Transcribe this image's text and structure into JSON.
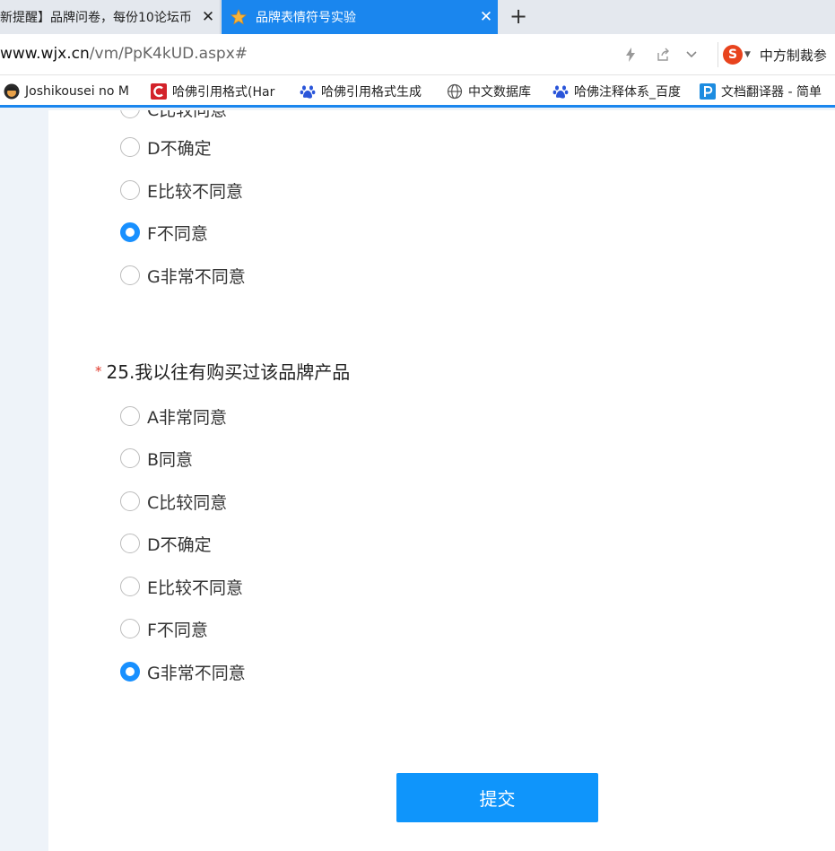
{
  "tabs": [
    {
      "title": "新提醒】品牌问卷，每份10论坛币",
      "close": "✕",
      "active": false
    },
    {
      "title": "品牌表情符号实验",
      "close": "✕",
      "active": true
    }
  ],
  "new_tab_label": "+",
  "address": {
    "host": "www.wjx.cn",
    "path": "/vm/PpK4kUD.aspx#"
  },
  "search_engine": {
    "logo": "S",
    "label": "中方制裁参"
  },
  "bookmarks": [
    {
      "label": "Joshikousei no M",
      "icon": "avatar-icon"
    },
    {
      "label": "哈佛引用格式(Har",
      "icon": "c-logo-icon"
    },
    {
      "label": "哈佛引用格式生成",
      "icon": "paw-icon"
    },
    {
      "label": "中文数据库",
      "icon": "globe-icon"
    },
    {
      "label": "哈佛注释体系_百度",
      "icon": "paw-icon"
    },
    {
      "label": "文档翻译器 - 简单",
      "icon": "p-logo-icon"
    }
  ],
  "prev_question": {
    "partial_option": "C比较同意",
    "options": [
      {
        "label": "D不确定",
        "checked": false
      },
      {
        "label": "E比较不同意",
        "checked": false
      },
      {
        "label": "F不同意",
        "checked": true
      },
      {
        "label": "G非常不同意",
        "checked": false
      }
    ]
  },
  "question25": {
    "required_mark": "*",
    "title": "25.我以往有购买过该品牌产品",
    "options": [
      {
        "label": "A非常同意",
        "checked": false
      },
      {
        "label": "B同意",
        "checked": false
      },
      {
        "label": "C比较同意",
        "checked": false
      },
      {
        "label": "D不确定",
        "checked": false
      },
      {
        "label": "E比较不同意",
        "checked": false
      },
      {
        "label": "F不同意",
        "checked": false
      },
      {
        "label": "G非常不同意",
        "checked": true
      }
    ]
  },
  "submit_label": "提交",
  "colors": {
    "accent": "#1890ff",
    "tab_active": "#1a86ee",
    "required": "#e0392b",
    "submit": "#0f95fb"
  }
}
